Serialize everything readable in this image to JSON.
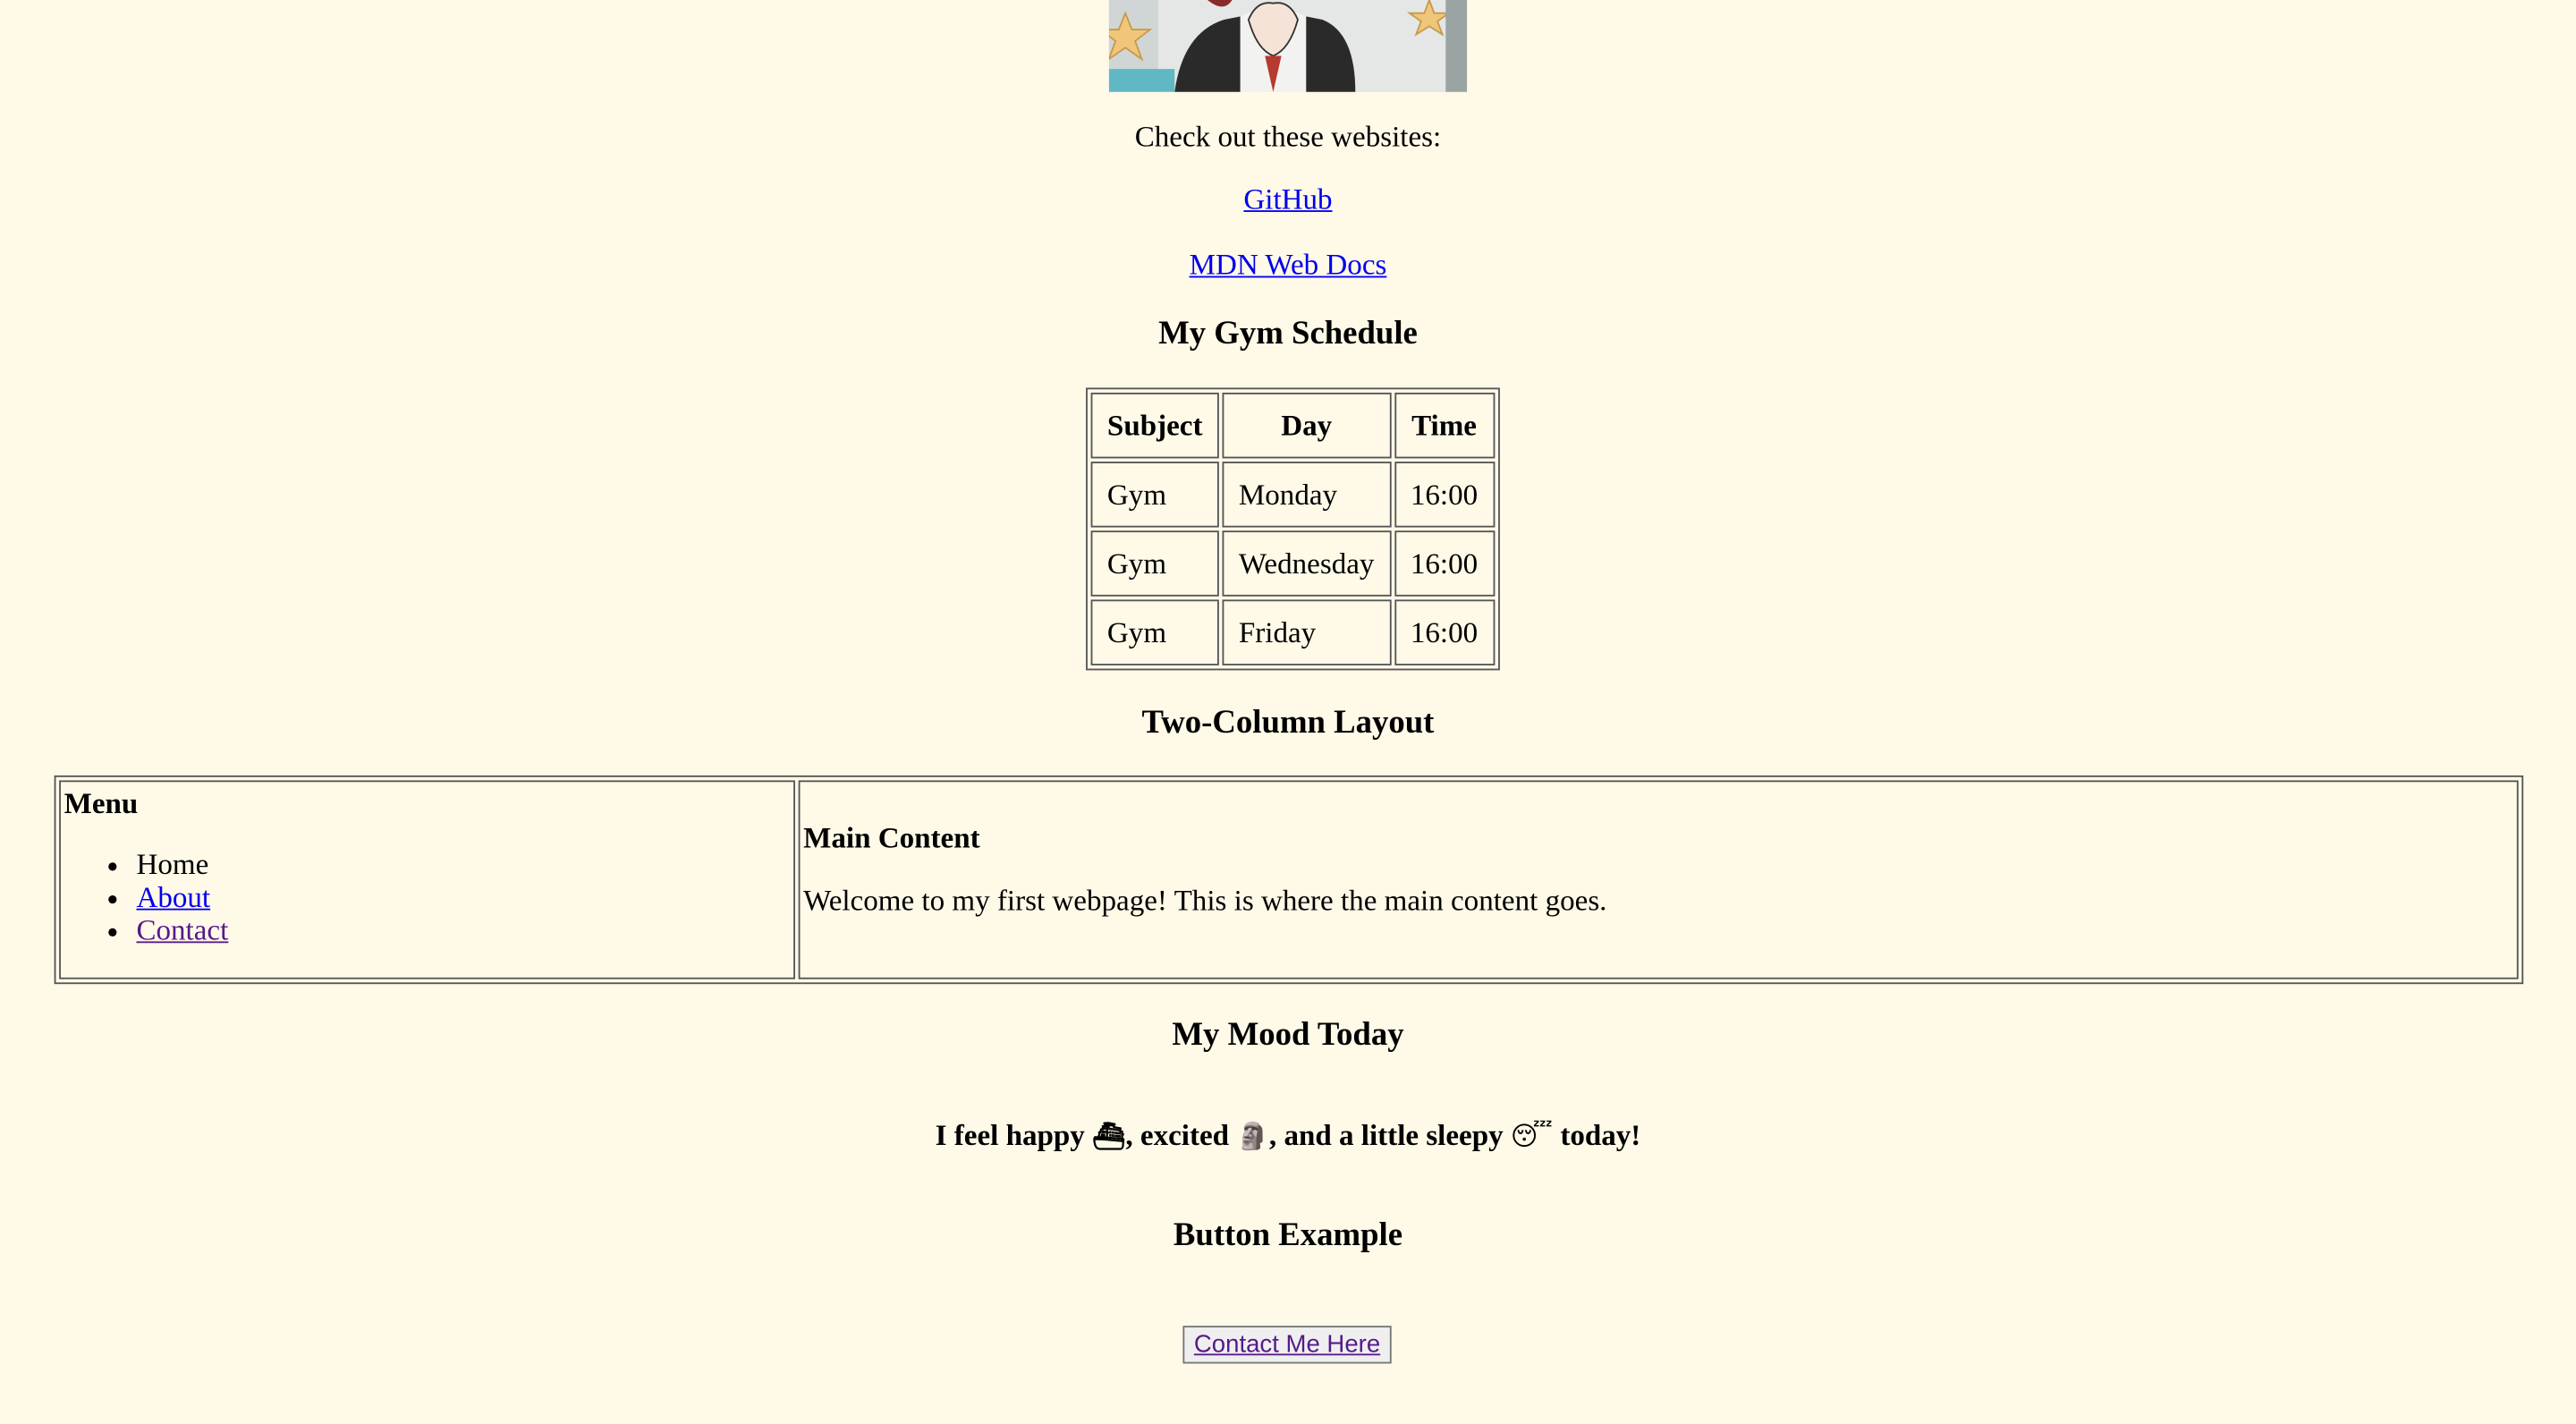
{
  "intro_text": "Check out these websites:",
  "links": {
    "github": "GitHub",
    "mdn": "MDN Web Docs"
  },
  "gym": {
    "heading": "My Gym Schedule",
    "headers": [
      "Subject",
      "Day",
      "Time"
    ],
    "rows": [
      [
        "Gym",
        "Monday",
        "16:00"
      ],
      [
        "Gym",
        "Wednesday",
        "16:00"
      ],
      [
        "Gym",
        "Friday",
        "16:00"
      ]
    ]
  },
  "two_column": {
    "heading": "Two-Column Layout",
    "menu_title": "Menu",
    "menu_items": [
      "Home",
      "About",
      "Contact"
    ],
    "main_title": "Main Content",
    "main_text": "Welcome to my first webpage! This is where the main content goes."
  },
  "mood": {
    "heading": "My Mood Today",
    "part1": "I feel happy ",
    "emoji1": "⛴",
    "part2": ", excited ",
    "emoji2": "🗿",
    "part3": ", and a little sleepy ",
    "emoji3": "😴",
    "part4": " today!"
  },
  "button_section": {
    "heading": "Button Example",
    "button_label": "Contact Me Here"
  },
  "colors": {
    "background": "#fff9e8",
    "link": "#0000ee",
    "visited_link": "#551a8b"
  }
}
